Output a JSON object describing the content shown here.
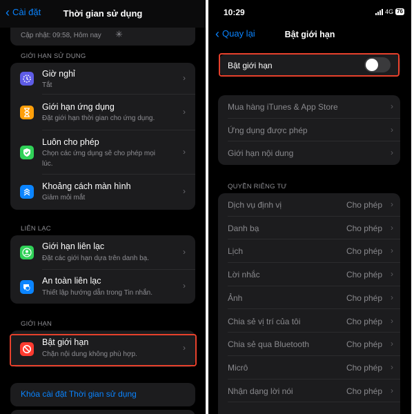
{
  "left": {
    "nav": {
      "back_label": "Cài đặt",
      "title": "Thời gian sử dụng"
    },
    "update_text": "Cập nhật: 09:58, Hôm nay",
    "limits_header": "GIỚI HẠN SỬ DỤNG",
    "limits_items": [
      {
        "title": "Giờ nghỉ",
        "subtitle": "Tắt",
        "icon": "downtime-icon",
        "color": "#5e5ce6"
      },
      {
        "title": "Giới hạn ứng dụng",
        "subtitle": "Đặt giới hạn thời gian cho ứng dụng.",
        "icon": "hourglass-icon",
        "color": "#ff9f0a"
      },
      {
        "title": "Luôn cho phép",
        "subtitle": "Chọn các ứng dụng sẽ cho phép mọi lúc.",
        "icon": "checkmark-shield-icon",
        "color": "#30d158"
      },
      {
        "title": "Khoảng cách màn hình",
        "subtitle": "Giảm mỏi mắt",
        "icon": "screen-distance-icon",
        "color": "#0a84ff"
      }
    ],
    "contact_header": "LIÊN LẠC",
    "contact_items": [
      {
        "title": "Giới hạn liên lạc",
        "subtitle": "Đặt các giới hạn dựa trên danh bạ.",
        "icon": "contact-icon",
        "color": "#30d158"
      },
      {
        "title": "An toàn liên lạc",
        "subtitle": "Thiết lập hướng dẫn trong Tin nhắn.",
        "icon": "message-shield-icon",
        "color": "#0a84ff"
      }
    ],
    "restrict_header": "GIỚI HẠN",
    "restrict_item": {
      "title": "Bật giới hạn",
      "subtitle": "Chặn nội dung không phù hợp.",
      "icon": "no-entry-icon",
      "color": "#ff3b30"
    },
    "lock_label": "Khóa cài đặt Thời gian sử dụng"
  },
  "right": {
    "status": {
      "time": "10:29",
      "network": "4G",
      "battery": "76"
    },
    "nav": {
      "back_label": "Quay lại",
      "title": "Bật giới hạn"
    },
    "toggle": {
      "label": "Bật giới hạn",
      "on": false
    },
    "store_items": [
      {
        "label": "Mua hàng iTunes & App Store"
      },
      {
        "label": "Ứng dụng được phép"
      },
      {
        "label": "Giới hạn nội dung"
      }
    ],
    "privacy_header": "QUYỀN RIÊNG TƯ",
    "privacy_items": [
      {
        "label": "Dịch vụ định vị",
        "value": "Cho phép"
      },
      {
        "label": "Danh bạ",
        "value": "Cho phép"
      },
      {
        "label": "Lịch",
        "value": "Cho phép"
      },
      {
        "label": "Lời nhắc",
        "value": "Cho phép"
      },
      {
        "label": "Ảnh",
        "value": "Cho phép"
      },
      {
        "label": "Chia sẻ vị trí của tôi",
        "value": "Cho phép"
      },
      {
        "label": "Chia sẻ qua Bluetooth",
        "value": "Cho phép"
      },
      {
        "label": "Micrô",
        "value": "Cho phép"
      },
      {
        "label": "Nhận dạng lời nói",
        "value": "Cho phép"
      }
    ]
  },
  "colors": {
    "accent": "#0a84ff",
    "highlight": "#e8412c",
    "cell": "#1c1c1e"
  }
}
